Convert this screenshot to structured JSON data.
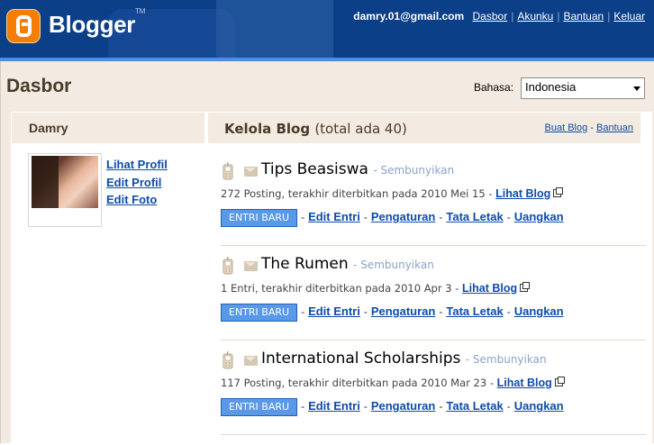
{
  "header": {
    "logo_text": "Blogger",
    "logo_tm": "TM",
    "email": "damry.01@gmail.com",
    "links": [
      "Dasbor",
      "Akunku",
      "Bantuan",
      "Keluar"
    ]
  },
  "page": {
    "title": "Dasbor",
    "language_label": "Bahasa:",
    "language_value": "Indonesia"
  },
  "profile": {
    "name": "Damry",
    "links": [
      "Lihat Profil",
      "Edit Profil",
      "Edit Foto"
    ]
  },
  "blogs_header": {
    "title": "Kelola Blog",
    "total": "(total ada 40)",
    "create_link": "Buat Blog",
    "separator": " - ",
    "help_link": "Bantuan"
  },
  "blogs": [
    {
      "name": "Tips Beasiswa",
      "hide": "- Sembunyikan",
      "info": "272 Posting, terakhir diterbitkan pada 2010 Mei 15 -",
      "view_link": "Lihat Blog",
      "new_entry": "ENTRI BARU",
      "edit_link": "Edit Entri",
      "settings_link": "Pengaturan",
      "layout_link": "Tata Letak",
      "monetize_link": "Uangkan"
    },
    {
      "name": "The Rumen",
      "hide": "- Sembunyikan",
      "info": "1 Entri, terakhir diterbitkan pada 2010 Apr 3 -",
      "view_link": "Lihat Blog",
      "new_entry": "ENTRI BARU",
      "edit_link": "Edit Entri",
      "settings_link": "Pengaturan",
      "layout_link": "Tata Letak",
      "monetize_link": "Uangkan"
    },
    {
      "name": "International Scholarships",
      "hide": "- Sembunyikan",
      "info": "117 Posting, terakhir diterbitkan pada 2010 Mar 23 -",
      "view_link": "Lihat Blog",
      "new_entry": "ENTRI BARU",
      "edit_link": "Edit Entri",
      "settings_link": "Pengaturan",
      "layout_link": "Tata Letak",
      "monetize_link": "Uangkan"
    }
  ],
  "colors": {
    "header_bg": "#0b3f88",
    "page_bg": "#f3ebe1",
    "link": "#0e4bab",
    "button": "#5a98e8",
    "logo_orange": "#f57d00"
  }
}
